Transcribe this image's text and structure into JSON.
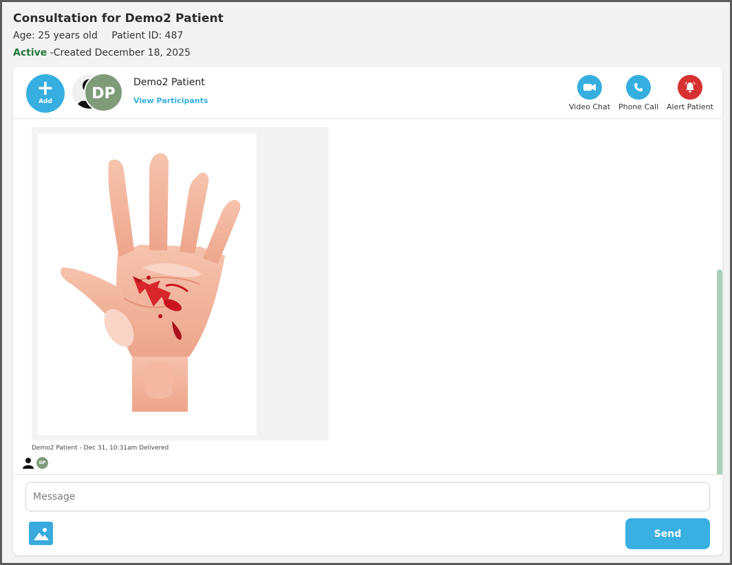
{
  "header": {
    "title": "Consultation for Demo2 Patient",
    "age": "Age: 25 years old",
    "patient_id": "Patient ID: 487",
    "status": "Active",
    "created": " -Created December 18, 2025"
  },
  "topbar": {
    "add_label": "Add",
    "avatar_initials": "DP",
    "patient_name": "Demo2 Patient",
    "view_participants": "View Participants",
    "actions": {
      "video": "Video Chat",
      "phone": "Phone Call",
      "alert": "Alert Patient"
    }
  },
  "chat": {
    "message_meta": "Demo2 Patient - Dec 31, 10:31am Delivered",
    "read_initials": "DP"
  },
  "composer": {
    "placeholder": "Message",
    "send_label": "Send"
  },
  "colors": {
    "accent": "#36aee0",
    "active_status": "#1f7a3a",
    "alert": "#d63031",
    "avatar": "#7f9b7a"
  },
  "icons": [
    "plus-icon",
    "user-silhouette-icon",
    "video-camera-icon",
    "phone-icon",
    "bell-icon",
    "image-icon"
  ]
}
